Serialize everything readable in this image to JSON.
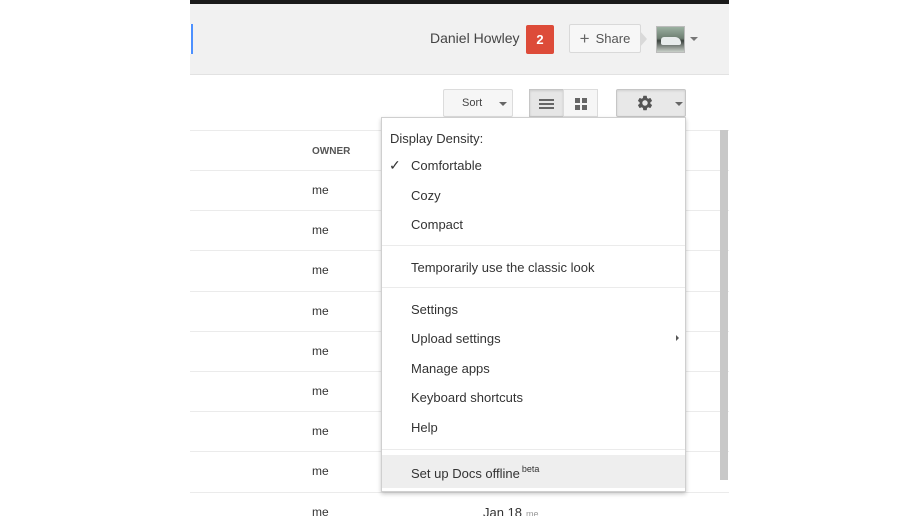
{
  "header": {
    "user_name": "Daniel Howley",
    "notification_count": "2",
    "share_label": "Share",
    "colors": {
      "notification_badge": "#dd4b39",
      "search_focus": "#4d90fe"
    }
  },
  "toolbar": {
    "sort_label": "Sort",
    "icons": {
      "list_view": "list-icon",
      "grid_view": "grid-icon",
      "settings": "gear-icon"
    }
  },
  "file_list": {
    "owner_header": "OWNER",
    "rows": [
      {
        "owner": "me",
        "date": "",
        "date_owner": ""
      },
      {
        "owner": "me",
        "date": "",
        "date_owner": ""
      },
      {
        "owner": "me",
        "date": "",
        "date_owner": ""
      },
      {
        "owner": "me",
        "date": "",
        "date_owner": ""
      },
      {
        "owner": "me",
        "date": "",
        "date_owner": ""
      },
      {
        "owner": "me",
        "date": "",
        "date_owner": ""
      },
      {
        "owner": "me",
        "date": "",
        "date_owner": ""
      },
      {
        "owner": "me",
        "date": "",
        "date_owner": ""
      },
      {
        "owner": "me",
        "date": "Jan 18",
        "date_owner": "me"
      }
    ]
  },
  "settings_menu": {
    "density_heading": "Display Density:",
    "density_options": [
      {
        "label": "Comfortable",
        "checked": true
      },
      {
        "label": "Cozy",
        "checked": false
      },
      {
        "label": "Compact",
        "checked": false
      }
    ],
    "classic_look": "Temporarily use the classic look",
    "items": [
      {
        "label": "Settings",
        "submenu": false
      },
      {
        "label": "Upload settings",
        "submenu": true
      },
      {
        "label": "Manage apps",
        "submenu": false
      },
      {
        "label": "Keyboard shortcuts",
        "submenu": false
      },
      {
        "label": "Help",
        "submenu": false
      }
    ],
    "offline_label": "Set up Docs offline",
    "offline_badge": "beta"
  }
}
